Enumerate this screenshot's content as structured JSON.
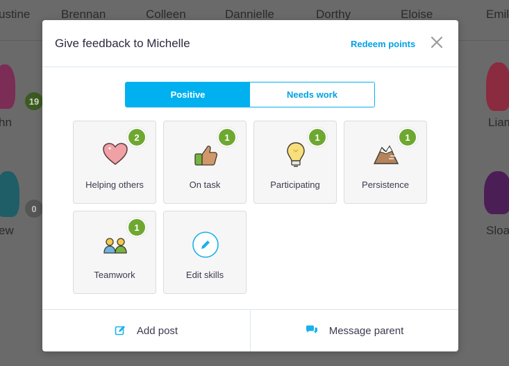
{
  "background": {
    "top_names": [
      "ustine",
      "Brennan",
      "Colleen",
      "Dannielle",
      "Dorthy",
      "Eloise",
      "Emil"
    ],
    "mid_left_name": "hn",
    "mid_left_points": "19",
    "mid_right_name": "Liam",
    "low_left_name": "ew",
    "low_left_points": "0",
    "low_right_name": "Sloa"
  },
  "modal": {
    "title": "Give feedback to Michelle",
    "redeem_label": "Redeem points",
    "close_icon": "close-icon"
  },
  "toggle": {
    "positive_label": "Positive",
    "needs_work_label": "Needs work",
    "active": "Positive"
  },
  "skills": [
    {
      "label": "Helping others",
      "points": "2",
      "icon": "heart-icon"
    },
    {
      "label": "On task",
      "points": "1",
      "icon": "thumbs-up-icon"
    },
    {
      "label": "Participating",
      "points": "1",
      "icon": "lightbulb-icon"
    },
    {
      "label": "Persistence",
      "points": "1",
      "icon": "mountain-icon"
    },
    {
      "label": "Teamwork",
      "points": "1",
      "icon": "team-icon"
    },
    {
      "label": "Edit skills",
      "icon": "pencil-icon"
    }
  ],
  "footer": {
    "add_post_label": "Add post",
    "message_parent_label": "Message parent"
  },
  "colors": {
    "accent": "#00b0ef",
    "badge_green": "#6ea830"
  }
}
